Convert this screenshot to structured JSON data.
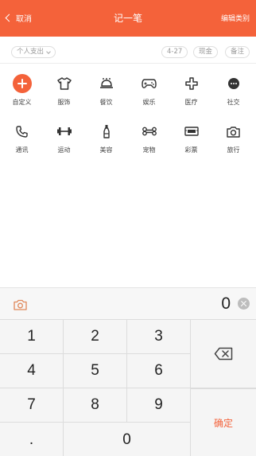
{
  "header": {
    "back_label": "取消",
    "title": "记一笔",
    "edit_label": "编辑类别",
    "color": "#f4623a"
  },
  "subbar": {
    "type_label": "个人支出",
    "date_label": "4-27",
    "account_label": "现金",
    "note_label": "备注"
  },
  "categories": [
    {
      "label": "自定义",
      "icon": "plus-circle-icon"
    },
    {
      "label": "服饰",
      "icon": "shirt-icon"
    },
    {
      "label": "餐饮",
      "icon": "dish-cloche-icon"
    },
    {
      "label": "娱乐",
      "icon": "gamepad-icon"
    },
    {
      "label": "医疗",
      "icon": "medical-cross-icon"
    },
    {
      "label": "社交",
      "icon": "chat-bubble-icon"
    },
    {
      "label": "通讯",
      "icon": "phone-icon"
    },
    {
      "label": "运动",
      "icon": "dumbbell-icon"
    },
    {
      "label": "美容",
      "icon": "perfume-bottle-icon"
    },
    {
      "label": "宠物",
      "icon": "bone-icon"
    },
    {
      "label": "彩票",
      "icon": "lottery-ticket-icon"
    },
    {
      "label": "旅行",
      "icon": "camera-icon"
    }
  ],
  "amount": {
    "value": "0"
  },
  "keypad": {
    "keys": [
      "1",
      "2",
      "3",
      "4",
      "5",
      "6",
      "7",
      "8",
      "9",
      ".",
      "0"
    ],
    "confirm_label": "确定"
  }
}
